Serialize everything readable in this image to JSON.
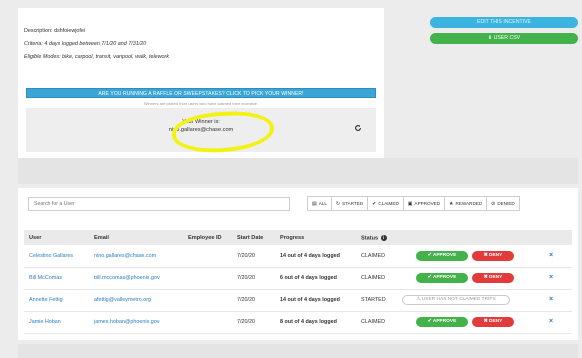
{
  "incentive": {
    "description": "Description: dshfoiewjofei",
    "criteria": "Criteria: 4 days logged between 7/1/20 and 7/31/20",
    "eligible_modes": "Eligible Modes: bike, carpool, transit, vanpool, walk, telework"
  },
  "actions": {
    "edit_label": "EDIT THIS INCENTIVE",
    "csv_label": "USER CSV"
  },
  "raffle": {
    "button_label": "ARE YOU RUNNING A RAFFLE OR SWEEPSTAKES? CLICK TO PICK YOUR WINNER!",
    "note": "Winners are picked from users who have claimed their incentive.",
    "winner_label": "Your Winner is:",
    "winner_email": "nino.gallares@chase.com"
  },
  "search": {
    "placeholder": "Search for a User"
  },
  "filters": [
    {
      "label": "ALL",
      "icon": "bars-icon"
    },
    {
      "label": "STARTED",
      "icon": "refresh-icon"
    },
    {
      "label": "CLAIMED",
      "icon": "check-icon"
    },
    {
      "label": "APPROVED",
      "icon": "stamp-icon"
    },
    {
      "label": "REWARDED",
      "icon": "star-icon"
    },
    {
      "label": "DENIED",
      "icon": "ban-icon"
    }
  ],
  "table": {
    "columns": [
      "User",
      "Email",
      "Employee ID",
      "Start Date",
      "Progress",
      "Status"
    ],
    "rows": [
      {
        "user": "Celestino Gallares",
        "email": "nino.gallares@chase.com",
        "employee_id": "",
        "start_date": "7/20/20",
        "progress": "14 out of 4 days logged",
        "status": "CLAIMED"
      },
      {
        "user": "Bill McComas",
        "email": "bill.mccomas@phoenix.gov",
        "employee_id": "",
        "start_date": "7/20/20",
        "progress": "6 out of 4 days logged",
        "status": "CLAIMED"
      },
      {
        "user": "Annette Fettig",
        "email": "afettig@valleymetro.org",
        "employee_id": "",
        "start_date": "7/20/20",
        "progress": "14 out of 4 days logged",
        "status": "STARTED"
      },
      {
        "user": "Jamie Hoban",
        "email": "james.hoban@phoenix.gov",
        "employee_id": "",
        "start_date": "7/20/20",
        "progress": "8 out of 4 days logged",
        "status": "CLAIMED"
      }
    ],
    "approve_label": "APPROVE",
    "deny_label": "DENY",
    "not_claimed_label": "USER HAS NOT CLAIMED TRIPS"
  },
  "colors": {
    "approve": "#43b24a",
    "deny": "#e23b3b",
    "link": "#2a7fc1",
    "raffle": "#3da5d6",
    "highlight": "#f2f213"
  }
}
